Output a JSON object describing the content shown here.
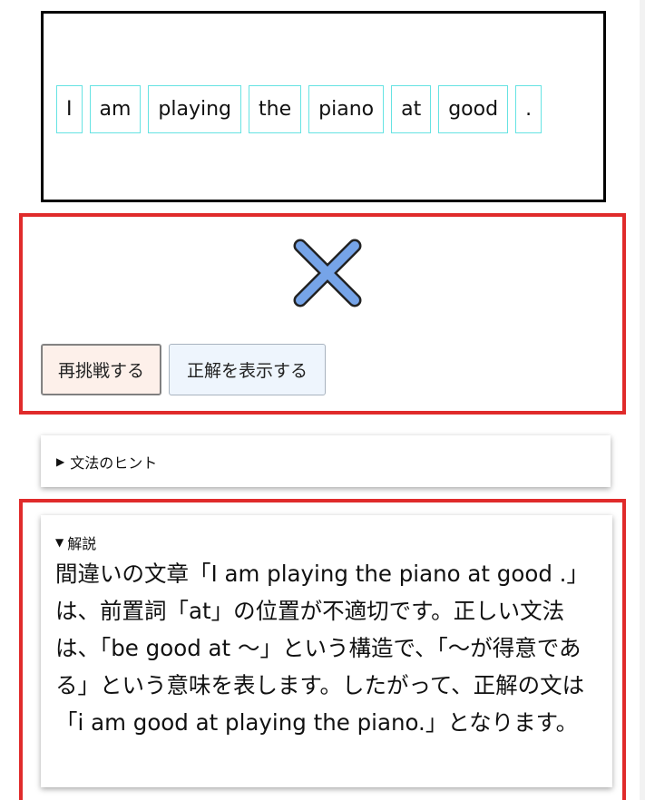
{
  "sentence": {
    "words": [
      "I",
      "am",
      "playing",
      "the",
      "piano",
      "at",
      "good",
      "."
    ]
  },
  "result": {
    "mark_icon": "x-mark-icon",
    "mark_color": "#76a4e8",
    "retry_label": "再挑戦する",
    "show_answer_label": "正解を表示する"
  },
  "hint": {
    "arrow": "▶",
    "label": "文法のヒント"
  },
  "explanation": {
    "arrow": "▼",
    "label": "解説",
    "text": "間違いの文章「I am playing the piano at good .」は、前置詞「at」の位置が不適切です。正しい文法は、「be good at 〜」という構造で、「〜が得意である」という意味を表します。したがって、正解の文は「i am good at playing the piano.」となります。"
  },
  "colors": {
    "error_border": "#e02b2b",
    "tile_border": "#66e3e3",
    "retry_bg": "#fdf0ea",
    "answer_bg": "#eef5fd"
  }
}
